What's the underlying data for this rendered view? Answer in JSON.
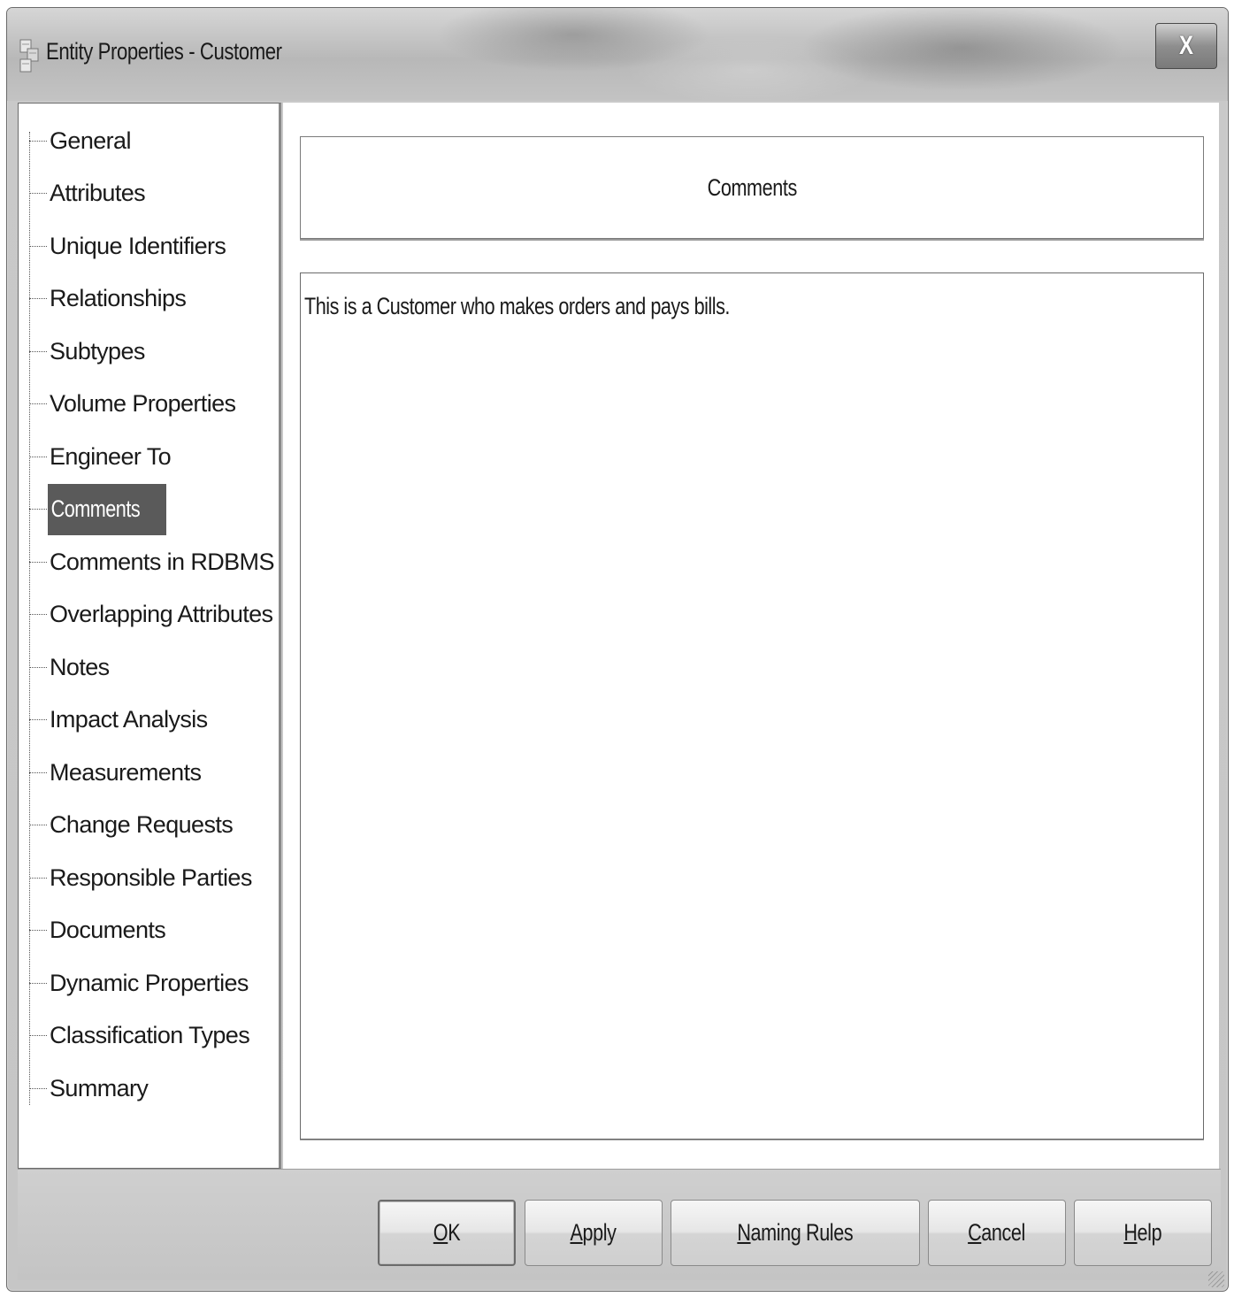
{
  "window": {
    "title": "Entity Properties - Customer",
    "close_label": "X"
  },
  "tree": {
    "items": [
      {
        "label": "General",
        "selected": false
      },
      {
        "label": "Attributes",
        "selected": false
      },
      {
        "label": "Unique Identifiers",
        "selected": false
      },
      {
        "label": "Relationships",
        "selected": false
      },
      {
        "label": "Subtypes",
        "selected": false
      },
      {
        "label": "Volume Properties",
        "selected": false
      },
      {
        "label": "Engineer To",
        "selected": false
      },
      {
        "label": "Comments",
        "selected": true
      },
      {
        "label": "Comments in RDBMS",
        "selected": false
      },
      {
        "label": "Overlapping Attributes",
        "selected": false
      },
      {
        "label": "Notes",
        "selected": false
      },
      {
        "label": "Impact Analysis",
        "selected": false
      },
      {
        "label": "Measurements",
        "selected": false
      },
      {
        "label": "Change Requests",
        "selected": false
      },
      {
        "label": "Responsible Parties",
        "selected": false
      },
      {
        "label": "Documents",
        "selected": false
      },
      {
        "label": "Dynamic Properties",
        "selected": false
      },
      {
        "label": "Classification Types",
        "selected": false
      },
      {
        "label": "Summary",
        "selected": false
      }
    ]
  },
  "content": {
    "header": "Comments",
    "comment_text": "This is a Customer who makes orders and pays bills."
  },
  "buttons": {
    "ok": {
      "mnemonic": "O",
      "rest": "K"
    },
    "apply": {
      "mnemonic": "A",
      "rest": "pply"
    },
    "naming_rules": {
      "mnemonic": "N",
      "rest": "aming Rules"
    },
    "cancel": {
      "mnemonic": "C",
      "rest": "ancel"
    },
    "help": {
      "mnemonic": "H",
      "rest": "elp"
    }
  }
}
